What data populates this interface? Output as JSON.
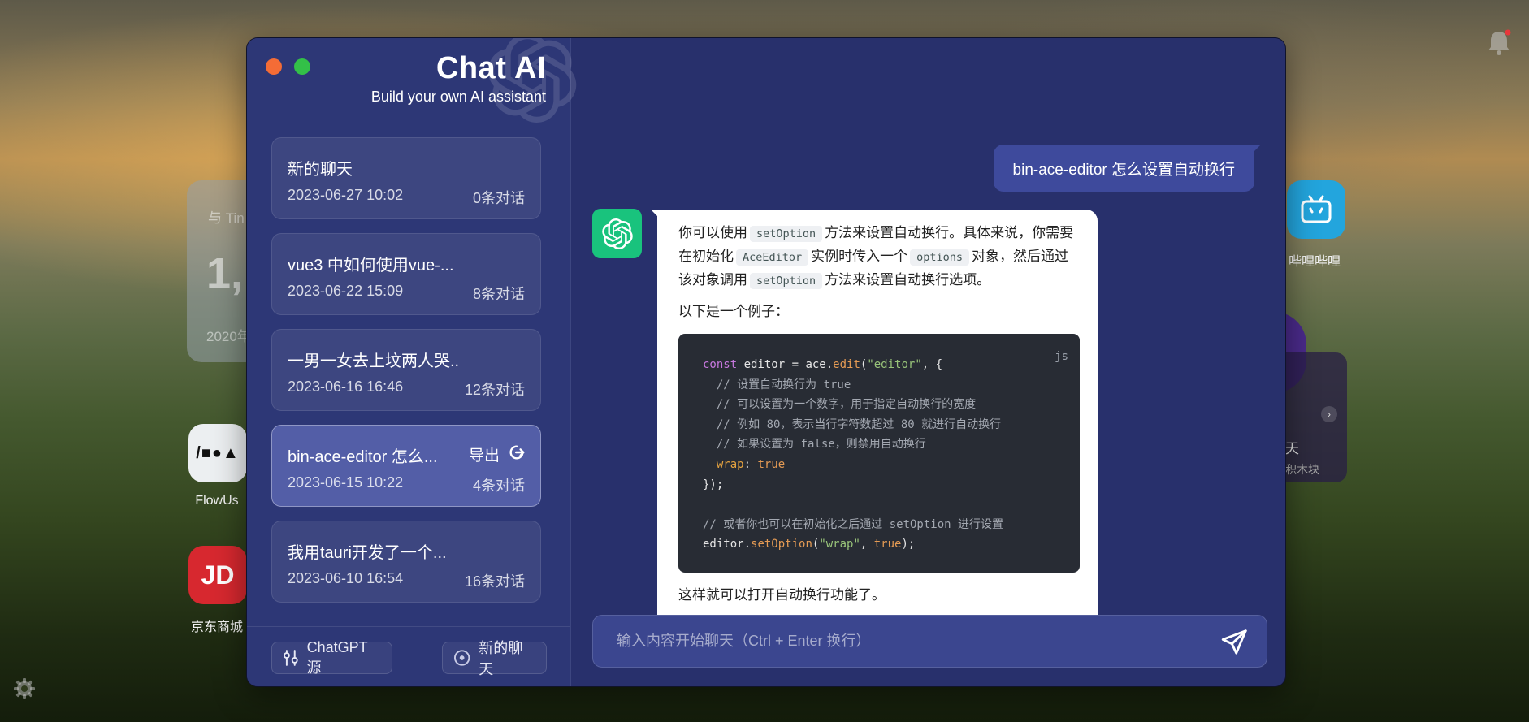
{
  "desktop": {
    "card_label": "与 Tin",
    "card_number": "1,",
    "card_footer": "2020年",
    "flowus_label": "FlowUs",
    "flowus_tile_text": "/■●▲",
    "jd_label": "京东商城",
    "jd_tile_text": "JD",
    "bilibili_label": "哔哩哔哩",
    "right_card_line1": "天",
    "right_card_line2": "积木块",
    "right_card_arrow": "›"
  },
  "app": {
    "title": "Chat AI",
    "subtitle": "Build your own AI assistant"
  },
  "conversations": [
    {
      "title": "新的聊天",
      "date": "2023-06-27 10:02",
      "count": "0条对话"
    },
    {
      "title": "vue3 中如何使用vue-...",
      "date": "2023-06-22 15:09",
      "count": "8条对话"
    },
    {
      "title": "一男一女去上坟两人哭...",
      "date": "2023-06-16 16:46",
      "count": "12条对话"
    },
    {
      "title": "bin-ace-editor 怎么...",
      "date": "2023-06-15 10:22",
      "count": "4条对话",
      "export_label": "导出"
    },
    {
      "title": "我用tauri开发了一个...",
      "date": "2023-06-10 16:54",
      "count": "16条对话"
    }
  ],
  "sidebar_buttons": {
    "source": "ChatGPT源",
    "new_chat": "新的聊天"
  },
  "chat": {
    "user_message": "bin-ace-editor 怎么设置自动换行",
    "ai_p1_a": "你可以使用",
    "ai_p1_code1": "setOption",
    "ai_p1_b": "方法来设置自动换行。具体来说，你需要在初始化",
    "ai_p1_code2": "AceEditor",
    "ai_p1_c": "实例时传入一个",
    "ai_p1_code3": "options",
    "ai_p1_d": "对象，然后通过该对象调用",
    "ai_p1_code4": "setOption",
    "ai_p1_e": "方法来设置自动换行选项。",
    "ai_p2": "以下是一个例子：",
    "code_lang": "js",
    "code": {
      "l1_kw": "const",
      "l1_a": " editor = ace.",
      "l1_fn": "edit",
      "l1_b": "(",
      "l1_str": "\"editor\"",
      "l1_c": ", {",
      "l2": "  // 设置自动换行为 true",
      "l3": "  // 可以设置为一个数字，用于指定自动换行的宽度",
      "l4": "  // 例如 80，表示当行字符数超过 80 就进行自动换行",
      "l5": "  // 如果设置为 false，则禁用自动换行",
      "l6_prop": "  wrap",
      "l6_a": ": ",
      "l6_val": "true",
      "l7": "});",
      "l9": "// 或者你也可以在初始化之后通过 setOption 进行设置",
      "l10_a": "editor.",
      "l10_fn": "setOption",
      "l10_b": "(",
      "l10_str": "\"wrap\"",
      "l10_c": ", ",
      "l10_val": "true",
      "l10_d": ");"
    },
    "ai_p3": "这样就可以打开自动换行功能了。"
  },
  "input": {
    "placeholder": "输入内容开始聊天（Ctrl + Enter 换行）",
    "value": ""
  },
  "icons": {
    "send": "send-icon",
    "export": "export-icon",
    "settings": "gear-icon",
    "bell": "bell-icon"
  },
  "colors": {
    "window_bg": "#28306c",
    "sidebar_bg": "#2d3776",
    "accent_green": "#19c37d",
    "user_bubble": "#3e4a9c"
  }
}
